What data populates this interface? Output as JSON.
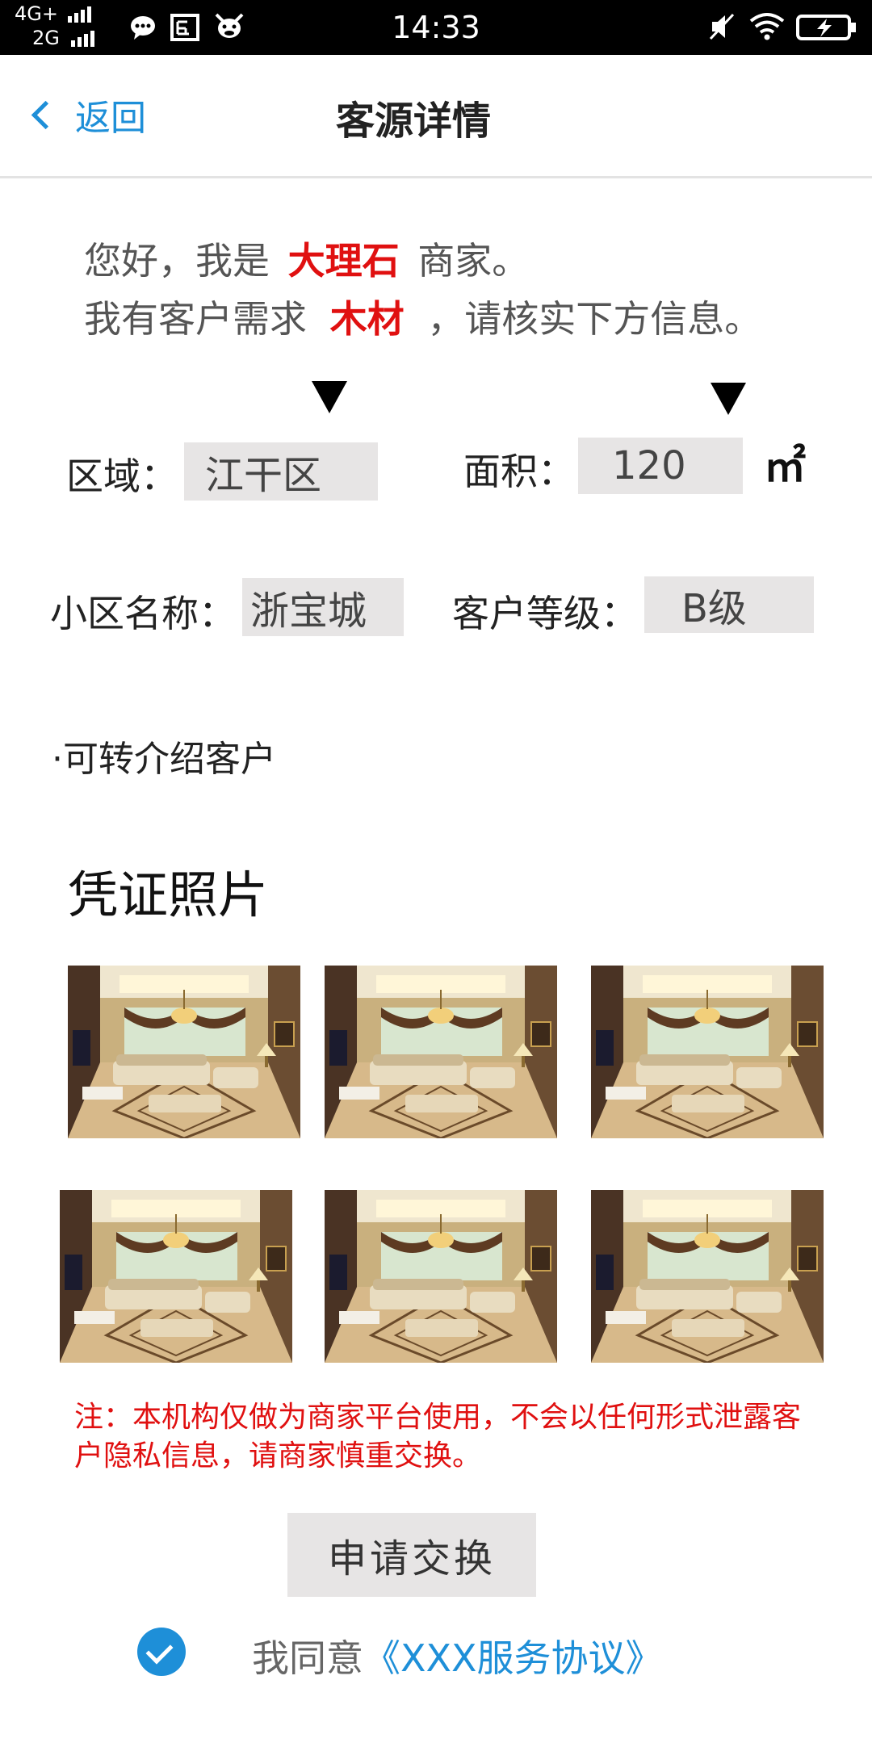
{
  "status_bar": {
    "network_top": "4G+",
    "network_bottom": "2G",
    "time": "14:33",
    "icons": [
      "chat-icon",
      "screenshot-icon",
      "app-icon",
      "mute-icon",
      "wifi-icon",
      "battery-charging-icon"
    ]
  },
  "header": {
    "back_label": "返回",
    "title": "客源详情"
  },
  "intro": {
    "line1_prefix": "您好，我是",
    "merchant_type": "大理石",
    "line1_suffix": "商家。",
    "line2_prefix": "我有客户需求",
    "demand_type": "木材",
    "line2_suffix": "，请核实下方信息。"
  },
  "form": {
    "region_label": "区域：",
    "region_value": "江干区",
    "area_label": "面积：",
    "area_value": "120",
    "area_unit": "㎡",
    "community_label": "小区名称：",
    "community_value": "浙宝城",
    "grade_label": "客户等级：",
    "grade_value": "B级"
  },
  "referral_note": "·可转介绍客户",
  "photos": {
    "title": "凭证照片",
    "count": 6
  },
  "notice": "注：本机构仅做为商家平台使用，不会以任何形式泄露客户隐私信息，请商家慎重交换。",
  "apply_button": "申请交换",
  "agreement": {
    "checked": true,
    "prefix": "我同意",
    "link": "《XXX服务协议》"
  },
  "colors": {
    "accent": "#1e8fd8",
    "highlight": "#e01010",
    "field_bg": "#e7e5e5"
  }
}
